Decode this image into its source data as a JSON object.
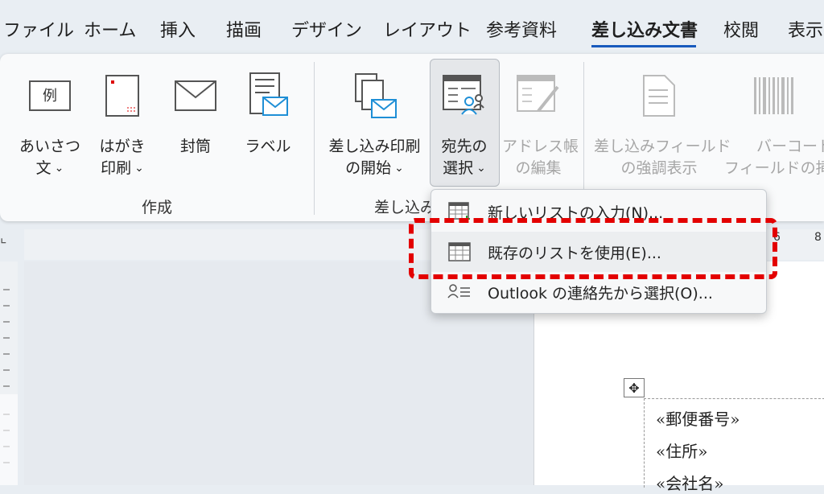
{
  "tabs": [
    {
      "label": "ファイル"
    },
    {
      "label": "ホーム"
    },
    {
      "label": "挿入"
    },
    {
      "label": "描画"
    },
    {
      "label": "デザイン"
    },
    {
      "label": "レイアウト"
    },
    {
      "label": "参考資料"
    },
    {
      "label": "差し込み文書",
      "active": true
    },
    {
      "label": "校閲"
    },
    {
      "label": "表示"
    }
  ],
  "ribbon": {
    "greeting": {
      "line1": "あいさつ",
      "line2": "文",
      "icon_text": "例"
    },
    "postcard": {
      "line1": "はがき",
      "line2": "印刷"
    },
    "envelope": {
      "line1": "封筒"
    },
    "label": {
      "line1": "ラベル"
    },
    "start_merge": {
      "line1": "差し込み印刷",
      "line2": "の開始"
    },
    "select_recipients": {
      "line1": "宛先の",
      "line2": "選択"
    },
    "edit_list": {
      "line1": "アドレス帳",
      "line2": "の編集"
    },
    "highlight_fields": {
      "line1": "差し込みフィールド",
      "line2": "の強調表示"
    },
    "barcode": {
      "line1": "バーコード",
      "line2": "フィールドの挿入"
    },
    "groups": {
      "create": "作成",
      "merge": "差し込み"
    }
  },
  "dropdown": {
    "items": [
      {
        "label": "新しいリストの入力(N)..."
      },
      {
        "label": "既存のリストを使用(E)..."
      },
      {
        "label": "Outlook の連絡先から選択(O)..."
      }
    ]
  },
  "document": {
    "fields": [
      "«郵便番号»",
      "«住所»",
      "«会社名»"
    ]
  },
  "ruler": {
    "h_number": "8",
    "h_number2": "6"
  },
  "colors": {
    "accent": "#185abd",
    "highlight": "#e30000"
  }
}
